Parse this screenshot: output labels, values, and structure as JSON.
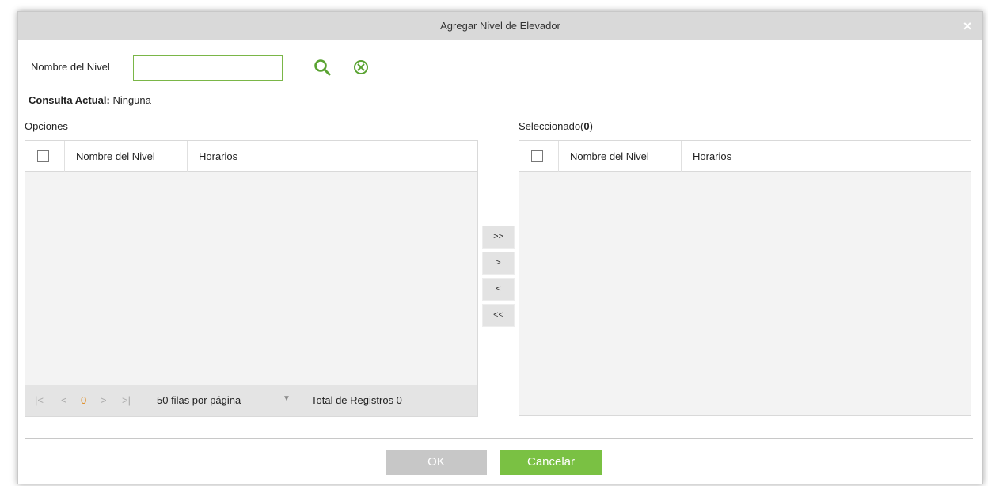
{
  "dialog": {
    "title": "Agregar Nivel de Elevador",
    "close_symbol": "×"
  },
  "search": {
    "label": "Nombre del Nivel",
    "value": "",
    "placeholder": "",
    "search_icon": "search-icon",
    "clear_icon": "clear-circle-icon",
    "icon_color": "#5aa332"
  },
  "query": {
    "label": "Consulta Actual:",
    "value": "Ninguna"
  },
  "options": {
    "label": "Opciones",
    "columns": [
      "Nombre del Nivel",
      "Horarios"
    ],
    "rows": []
  },
  "pager": {
    "first": "|<",
    "prev": "<",
    "page": "0",
    "next": ">",
    "last": ">|",
    "per_page": "50 filas por página",
    "total": "Total de Registros 0"
  },
  "selected": {
    "label": "Seleccionado(",
    "count": "0",
    "label_end": ")",
    "columns": [
      "Nombre del Nivel",
      "Horarios"
    ],
    "rows": []
  },
  "move_buttons": {
    "add_all": ">>",
    "add": ">",
    "remove": "<",
    "remove_all": "<<"
  },
  "footer": {
    "ok": "OK",
    "cancel": "Cancelar"
  },
  "colors": {
    "accent": "#7ac143",
    "page_number": "#e08a1e",
    "disabled_button": "#c7c7c7"
  }
}
